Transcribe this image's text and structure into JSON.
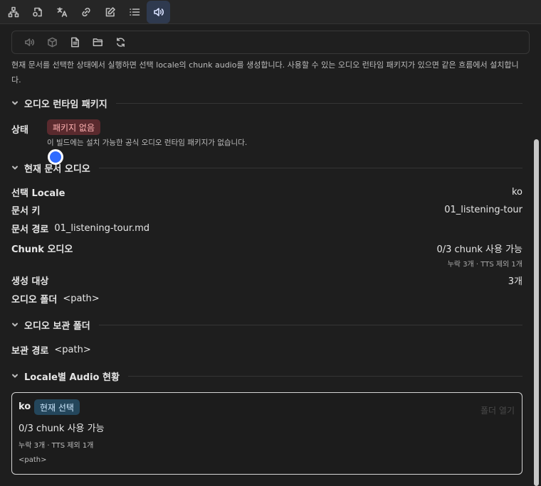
{
  "tabs": [
    {
      "icon": "sitemap-icon"
    },
    {
      "icon": "file-link-icon"
    },
    {
      "icon": "translate-icon"
    },
    {
      "icon": "link-icon"
    },
    {
      "icon": "edit-icon"
    },
    {
      "icon": "list-icon"
    },
    {
      "icon": "speaker-icon",
      "active": true
    }
  ],
  "toolbar": [
    "speaker-icon",
    "box-icon",
    "document-icon",
    "folder-icon",
    "refresh-icon"
  ],
  "description": "현재 문서를 선택한 상태에서 실행하면 선택 locale의 chunk audio를 생성합니다. 사용할 수 있는 오디오 런타임 패키지가 있으면 같은 흐름에서 설치합니다.",
  "runtime": {
    "section_title": "오디오 런타임 패키지",
    "status_label": "상태",
    "status_badge": "패키지 없음",
    "status_note": "이 빌드에는 설치 가능한 공식 오디오 런타임 패키지가 없습니다."
  },
  "current_doc": {
    "section_title": "현재 문서 오디오",
    "locale_label": "선택 Locale",
    "locale_value": "ko",
    "key_label": "문서 키",
    "key_value": "01_listening-tour",
    "path_label": "문서 경로",
    "path_value": "01_listening-tour.md",
    "chunk_label": "Chunk 오디오",
    "chunk_value": "0/3 chunk 사용 가능",
    "chunk_sub": "누락 3개 · TTS 제외 1개",
    "target_label": "생성 대상",
    "target_value": "3개",
    "folder_label": "오디오 폴더",
    "folder_value": "<path>"
  },
  "archive": {
    "section_title": "오디오 보관 폴더",
    "path_label": "보관 경로",
    "path_value": "<path>"
  },
  "locale_audio": {
    "section_title": "Locale별 Audio 현황",
    "cards": [
      {
        "locale": "ko",
        "badge": "현재 선택",
        "open_label": "폴더 열기",
        "available": "0/3 chunk 사용 가능",
        "missing": "누락 3개 · TTS 제외 1개",
        "path": "<path>"
      }
    ]
  },
  "colors": {
    "accent": "#2f6bff",
    "badge_red_bg": "#5a2a2e",
    "badge_teal_bg": "#24465b",
    "background": "#1e1e1e"
  }
}
